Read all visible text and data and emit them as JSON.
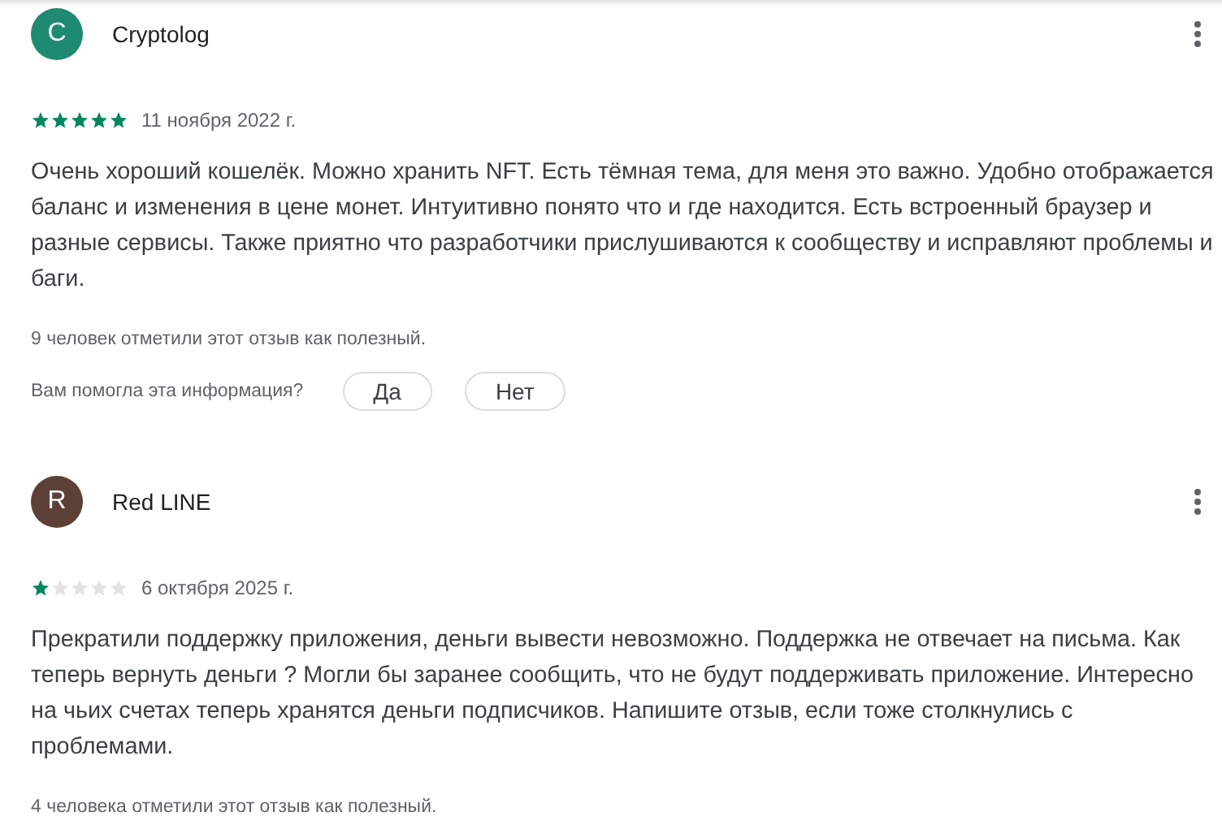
{
  "reviews": [
    {
      "author": "Cryptolog",
      "avatar_letter": "C",
      "color": "#1e8a72",
      "stars": 5,
      "date": "11 ноября 2022 г.",
      "text": "Очень хороший кошелёк. Можно хранить NFT. Есть тёмная тема, для меня это важно. Удобно отображается баланс и изменения в цене монет. Интуитивно понято что и где находится. Есть встроенный браузер и разные сервисы. Также приятно что разработчики прислушиваются к сообществу и исправляют проблемы и баги.",
      "helpful": "9 человек отметили этот отзыв как полезный.",
      "question": "Вам помогла эта информация?",
      "answers": [
        "Да",
        "Нет"
      ]
    },
    {
      "author": "Red LINE",
      "avatar_letter": "R",
      "color": "#5d4037",
      "stars": 1,
      "date": "6 октября 2025 г.",
      "text": "Прекратили поддержку приложения, деньги вывести невозможно. Поддержка не отвечает на письма. Как теперь вернуть деньги ? Могли бы заранее сообщить, что не будут поддерживать приложение. Интересно на чьих счетах теперь хранятся деньги подписчиков. Напишите отзыв, если тоже столкнулись с проблемами.",
      "helpful": "4 человека отметили этот отзыв как полезный."
    }
  ]
}
